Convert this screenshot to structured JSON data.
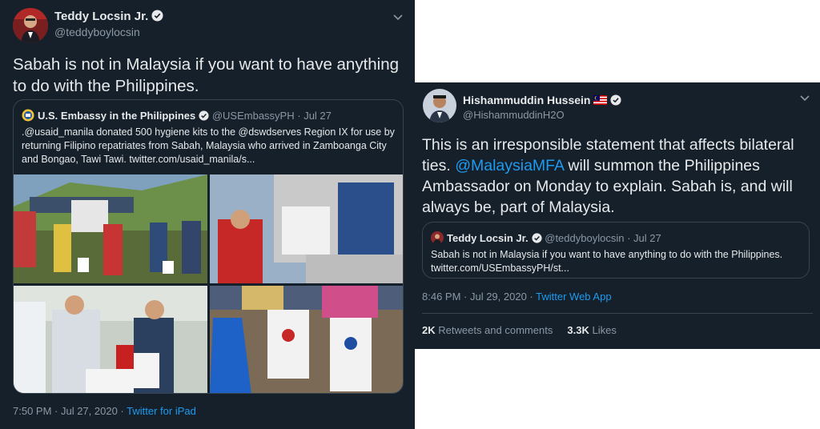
{
  "tweet1": {
    "author_name": "Teddy Locsin Jr.",
    "author_handle": "@teddyboylocsin",
    "text": "Sabah is not in Malaysia if you want to have anything to do with the Philippines.",
    "quoted": {
      "author_name": "U.S. Embassy in the Philippines",
      "author_handle": "@USEmbassyPH",
      "date": "· Jul 27",
      "text": ".@usaid_manila donated 500 hygiene kits to the @dswdserves Region IX for use by returning Filipino repatriates from Sabah, Malaysia who arrived in Zamboanga City and Bongao, Tawi Tawi. twitter.com/usaid_manila/s...",
      "photos": [
        {
          "caption": "Outdoor handover of hygiene kits under a tent",
          "sign_text": ""
        },
        {
          "caption": "Volunteers unloading bags from a truck",
          "sign_text": ""
        },
        {
          "caption": "Health workers in PPE handing over a bag",
          "sign_text": "OPLAN"
        },
        {
          "caption": "Recipients holding USAID bags",
          "bag_text": "USAID"
        }
      ]
    },
    "timestamp": "7:50 PM · Jul 27, 2020 ·",
    "source": "Twitter for iPad"
  },
  "tweet2": {
    "author_name": "Hishammuddin Hussein",
    "author_handle": "@HishammuddinH2O",
    "text_before": "This is an irresponsible statement that affects bilateral ties. ",
    "mention": "@MalaysiaMFA",
    "text_after": " will summon the Philippines Ambassador on Monday to explain. Sabah is, and will always be, part of Malaysia.",
    "quoted": {
      "author_name": "Teddy Locsin Jr.",
      "author_handle": "@teddyboylocsin",
      "date": "· Jul 27",
      "text": "Sabah is not in Malaysia if you want to have anything to do with the Philippines. twitter.com/USEmbassyPH/st..."
    },
    "timestamp": "8:46 PM · Jul 29, 2020 ·",
    "source": "Twitter Web App",
    "retweets_count": "2K",
    "retweets_label": "Retweets and comments",
    "likes_count": "3.3K",
    "likes_label": "Likes"
  },
  "colors": {
    "background": "#15202b",
    "border": "#38444d",
    "accent": "#1d9bf0",
    "muted": "#8b98a5",
    "text": "#e7e9ea"
  },
  "icons": [
    "verified-badge-icon",
    "chevron-down-icon",
    "malaysia-flag-icon",
    "us-embassy-seal-icon"
  ]
}
